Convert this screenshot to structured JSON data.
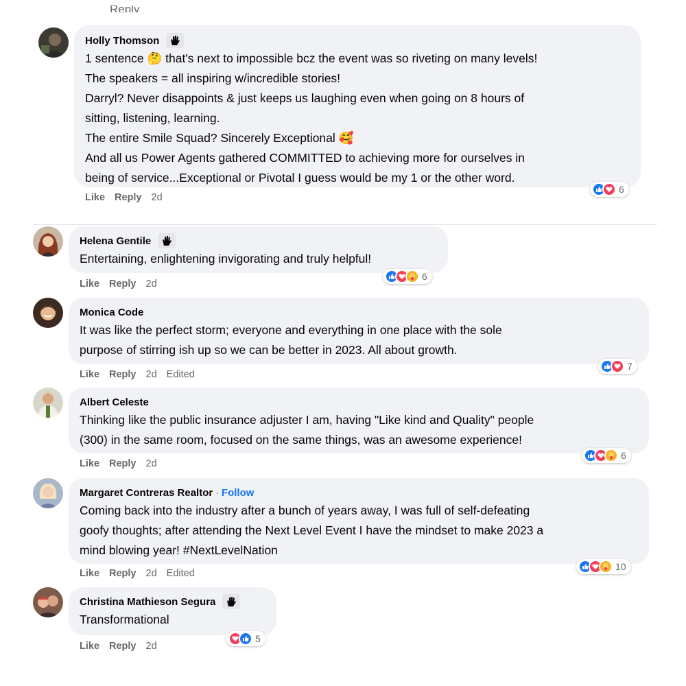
{
  "top_fragment": "Reply",
  "comments": [
    {
      "author": "Holly Thomson",
      "text": "1 sentence 🤔 that's next to impossible bcz the event was so riveting on many levels!\nThe speakers = all inspiring w/incredible stories!\nDarryl? Never disappoints & just keeps us laughing even when going on 8 hours of\nsitting, listening, learning.\nThe entire Smile Squad? Sincerely Exceptional 🥰\nAnd all us Power Agents gathered COMMITTED to achieving more for ourselves in\nbeing of service...Exceptional or Pivotal I guess would be my 1 or the other word.",
      "like_label": "Like",
      "reply_label": "Reply",
      "time": "2d",
      "reaction_count": "6"
    },
    {
      "author": "Helena Gentile",
      "text": "Entertaining, enlightening invigorating and truly helpful!",
      "like_label": "Like",
      "reply_label": "Reply",
      "time": "2d",
      "reaction_count": "6"
    },
    {
      "author": "Monica Code",
      "text": "It was like the perfect storm; everyone and everything in one place with the sole\npurpose of stirring ish up so we can be better in 2023. All about growth.",
      "like_label": "Like",
      "reply_label": "Reply",
      "time": "2d",
      "edited": "Edited",
      "reaction_count": "7"
    },
    {
      "author": "Albert Celeste",
      "text": "Thinking like the public insurance adjuster I am, having \"Like kind and Quality\" people\n(300) in the same room, focused on the same things, was an awesome experience!",
      "like_label": "Like",
      "reply_label": "Reply",
      "time": "2d",
      "reaction_count": "6"
    },
    {
      "author": "Margaret Contreras Realtor",
      "separator": "·",
      "follow_label": "Follow",
      "text": "Coming back into the industry after a bunch of years away, I was full of self-defeating\ngoofy thoughts; after attending the Next Level Event I have the mindset to make 2023 a\nmind blowing year! #NextLevelNation",
      "like_label": "Like",
      "reply_label": "Reply",
      "time": "2d",
      "edited": "Edited",
      "reaction_count": "10"
    },
    {
      "author": "Christina Mathieson Segura",
      "text": "Transformational",
      "like_label": "Like",
      "reply_label": "Reply",
      "time": "2d",
      "reaction_count": "5"
    }
  ],
  "colors": {
    "bubble": "#f0f2f5",
    "link": "#1877f2",
    "muted": "#65676b",
    "like": "#1877f2",
    "love": "#f33e58",
    "care": "#f7b125"
  }
}
